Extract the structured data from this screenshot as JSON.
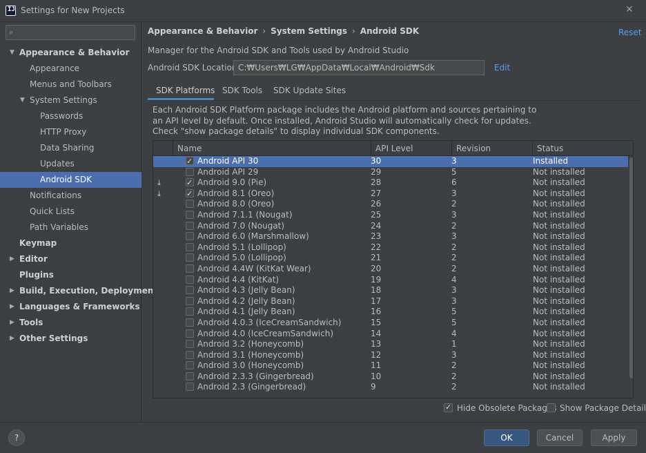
{
  "window": {
    "title": "Settings for New Projects",
    "app_icon_letter": "IJ"
  },
  "search": {
    "placeholder": "",
    "icon": "search-icon"
  },
  "sidebar": {
    "items": [
      {
        "label": "Appearance & Behavior",
        "level": 0,
        "bold": true,
        "arrow": "▼"
      },
      {
        "label": "Appearance",
        "level": 1
      },
      {
        "label": "Menus and Toolbars",
        "level": 1
      },
      {
        "label": "System Settings",
        "level": 1,
        "arrow": "▼"
      },
      {
        "label": "Passwords",
        "level": 2
      },
      {
        "label": "HTTP Proxy",
        "level": 2
      },
      {
        "label": "Data Sharing",
        "level": 2
      },
      {
        "label": "Updates",
        "level": 2
      },
      {
        "label": "Android SDK",
        "level": 2,
        "selected": true
      },
      {
        "label": "Notifications",
        "level": 1
      },
      {
        "label": "Quick Lists",
        "level": 1
      },
      {
        "label": "Path Variables",
        "level": 1
      },
      {
        "label": "Keymap",
        "level": 0,
        "bold": true
      },
      {
        "label": "Editor",
        "level": 0,
        "bold": true,
        "arrow": "▶"
      },
      {
        "label": "Plugins",
        "level": 0,
        "bold": true
      },
      {
        "label": "Build, Execution, Deployment",
        "level": 0,
        "bold": true,
        "arrow": "▶"
      },
      {
        "label": "Languages & Frameworks",
        "level": 0,
        "bold": true,
        "arrow": "▶"
      },
      {
        "label": "Tools",
        "level": 0,
        "bold": true,
        "arrow": "▶"
      },
      {
        "label": "Other Settings",
        "level": 0,
        "bold": true,
        "arrow": "▶"
      }
    ]
  },
  "breadcrumb": {
    "items": [
      "Appearance & Behavior",
      "System Settings",
      "Android SDK"
    ],
    "separator": "›"
  },
  "reset_label": "Reset",
  "description": "Manager for the Android SDK and Tools used by Android Studio",
  "sdk_location": {
    "label": "Android SDK Location:",
    "value": "C:₩Users₩LG₩AppData₩Local₩Android₩Sdk",
    "edit_label": "Edit"
  },
  "tabs": [
    "SDK Platforms",
    "SDK Tools",
    "SDK Update Sites"
  ],
  "panel_description": "Each Android SDK Platform package includes the Android platform and sources pertaining to an API level by default. Once installed, Android Studio will automatically check for updates. Check \"show package details\" to display individual SDK components.",
  "table": {
    "columns": [
      "Name",
      "API Level",
      "Revision",
      "Status"
    ],
    "rows": [
      {
        "checked": true,
        "download": false,
        "name": "Android API 30",
        "api": "30",
        "rev": "3",
        "status": "Installed",
        "selected": true
      },
      {
        "checked": false,
        "download": false,
        "name": "Android API 29",
        "api": "29",
        "rev": "5",
        "status": "Not installed"
      },
      {
        "checked": true,
        "download": true,
        "name": "Android 9.0 (Pie)",
        "api": "28",
        "rev": "6",
        "status": "Not installed"
      },
      {
        "checked": true,
        "download": true,
        "name": "Android 8.1 (Oreo)",
        "api": "27",
        "rev": "3",
        "status": "Not installed"
      },
      {
        "checked": false,
        "download": false,
        "name": "Android 8.0 (Oreo)",
        "api": "26",
        "rev": "2",
        "status": "Not installed"
      },
      {
        "checked": false,
        "download": false,
        "name": "Android 7.1.1 (Nougat)",
        "api": "25",
        "rev": "3",
        "status": "Not installed"
      },
      {
        "checked": false,
        "download": false,
        "name": "Android 7.0 (Nougat)",
        "api": "24",
        "rev": "2",
        "status": "Not installed"
      },
      {
        "checked": false,
        "download": false,
        "name": "Android 6.0 (Marshmallow)",
        "api": "23",
        "rev": "3",
        "status": "Not installed"
      },
      {
        "checked": false,
        "download": false,
        "name": "Android 5.1 (Lollipop)",
        "api": "22",
        "rev": "2",
        "status": "Not installed"
      },
      {
        "checked": false,
        "download": false,
        "name": "Android 5.0 (Lollipop)",
        "api": "21",
        "rev": "2",
        "status": "Not installed"
      },
      {
        "checked": false,
        "download": false,
        "name": "Android 4.4W (KitKat Wear)",
        "api": "20",
        "rev": "2",
        "status": "Not installed"
      },
      {
        "checked": false,
        "download": false,
        "name": "Android 4.4 (KitKat)",
        "api": "19",
        "rev": "4",
        "status": "Not installed"
      },
      {
        "checked": false,
        "download": false,
        "name": "Android 4.3 (Jelly Bean)",
        "api": "18",
        "rev": "3",
        "status": "Not installed"
      },
      {
        "checked": false,
        "download": false,
        "name": "Android 4.2 (Jelly Bean)",
        "api": "17",
        "rev": "3",
        "status": "Not installed"
      },
      {
        "checked": false,
        "download": false,
        "name": "Android 4.1 (Jelly Bean)",
        "api": "16",
        "rev": "5",
        "status": "Not installed"
      },
      {
        "checked": false,
        "download": false,
        "name": "Android 4.0.3 (IceCreamSandwich)",
        "api": "15",
        "rev": "5",
        "status": "Not installed"
      },
      {
        "checked": false,
        "download": false,
        "name": "Android 4.0 (IceCreamSandwich)",
        "api": "14",
        "rev": "4",
        "status": "Not installed"
      },
      {
        "checked": false,
        "download": false,
        "name": "Android 3.2 (Honeycomb)",
        "api": "13",
        "rev": "1",
        "status": "Not installed"
      },
      {
        "checked": false,
        "download": false,
        "name": "Android 3.1 (Honeycomb)",
        "api": "12",
        "rev": "3",
        "status": "Not installed"
      },
      {
        "checked": false,
        "download": false,
        "name": "Android 3.0 (Honeycomb)",
        "api": "11",
        "rev": "2",
        "status": "Not installed"
      },
      {
        "checked": false,
        "download": false,
        "name": "Android 2.3.3 (Gingerbread)",
        "api": "10",
        "rev": "2",
        "status": "Not installed"
      },
      {
        "checked": false,
        "download": false,
        "name": "Android 2.3 (Gingerbread)",
        "api": "9",
        "rev": "2",
        "status": "Not installed"
      }
    ]
  },
  "options": {
    "hide_obsolete": {
      "label": "Hide Obsolete Packages",
      "checked": true
    },
    "show_details": {
      "label": "Show Package Details",
      "checked": false
    }
  },
  "footer": {
    "help_label": "?",
    "ok_label": "OK",
    "cancel_label": "Cancel",
    "apply_label": "Apply"
  }
}
